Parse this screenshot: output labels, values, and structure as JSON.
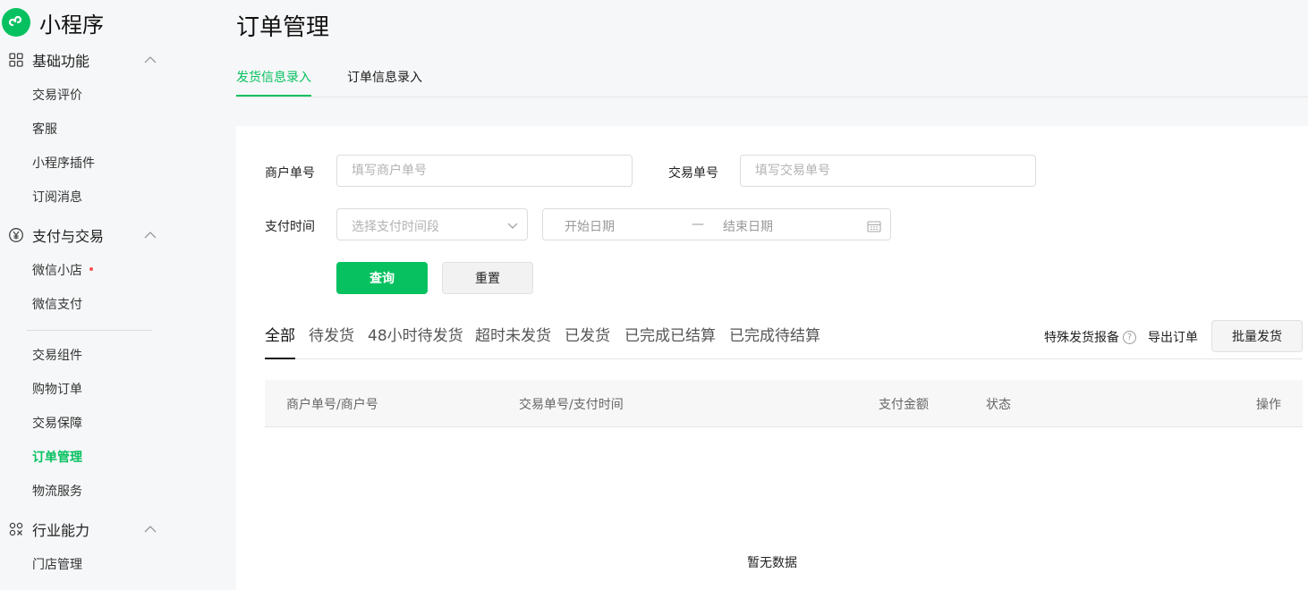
{
  "brand": {
    "name": "小程序",
    "color": "#07c160"
  },
  "sidebar": {
    "groups": [
      {
        "label": "基础功能",
        "icon": "grid-icon",
        "items": [
          "交易评价",
          "客服",
          "小程序插件",
          "订阅消息"
        ]
      },
      {
        "label": "支付与交易",
        "icon": "yen-circle-icon",
        "items": [
          "微信小店",
          "微信支付",
          "交易组件",
          "购物订单",
          "交易保障",
          "订单管理",
          "物流服务"
        ]
      },
      {
        "label": "行业能力",
        "icon": "industry-icon",
        "items": [
          "门店管理"
        ]
      }
    ],
    "active_item": "订单管理",
    "badge_item": "微信小店"
  },
  "header": {
    "title": "订单管理",
    "tabs": [
      "发货信息录入",
      "订单信息录入"
    ],
    "active_tab": 0
  },
  "filters": {
    "merchant_order_label": "商户单号",
    "merchant_order_placeholder": "填写商户单号",
    "trade_order_label": "交易单号",
    "trade_order_placeholder": "填写交易单号",
    "pay_time_label": "支付时间",
    "pay_time_placeholder": "选择支付时间段",
    "start_date_placeholder": "开始日期",
    "date_separator": "—",
    "end_date_placeholder": "结束日期",
    "query_button": "查询",
    "reset_button": "重置"
  },
  "status_tabs": [
    "全部",
    "待发货",
    "48小时待发货",
    "超时未发货",
    "已发货",
    "已完成已结算",
    "已完成待结算"
  ],
  "actions": {
    "special_report": "特殊发货报备",
    "help_glyph": "?",
    "export": "导出订单",
    "batch_ship": "批量发货"
  },
  "table": {
    "columns": [
      "商户单号/商户号",
      "交易单号/支付时间",
      "支付金额",
      "状态",
      "操作"
    ],
    "empty_text": "暂无数据"
  }
}
